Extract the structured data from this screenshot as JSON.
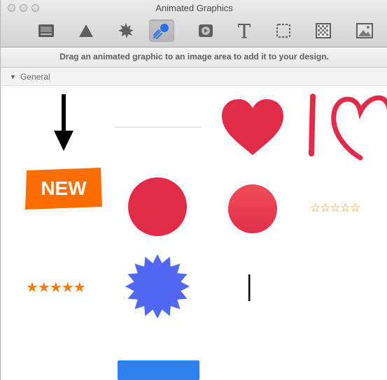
{
  "window": {
    "title": "Animated Graphics"
  },
  "toolbar": {
    "buttons": [
      {
        "icon": "text-box-icon",
        "selected": false
      },
      {
        "icon": "triangle-shape-icon",
        "selected": false
      },
      {
        "icon": "starburst-icon",
        "selected": false
      },
      {
        "icon": "animated-graphic-icon",
        "selected": true
      },
      {
        "icon": "video-icon",
        "selected": false
      },
      {
        "icon": "text-icon",
        "selected": false
      },
      {
        "icon": "image-placeholder-icon",
        "selected": false
      },
      {
        "icon": "pattern-icon",
        "selected": false
      },
      {
        "icon": "photo-icon",
        "selected": false
      }
    ]
  },
  "info": {
    "message": "Drag an animated graphic to an image area to add it to your design."
  },
  "section": {
    "label": "General",
    "expanded": true
  },
  "graphics": {
    "new_badge": "NEW",
    "empty_stars": "☆☆☆☆☆",
    "filled_stars": "★★★★★"
  },
  "colors": {
    "red": "#e02c48",
    "orange": "#ff6e00",
    "blue": "#5068f2",
    "button_blue": "#2f7ff0"
  }
}
